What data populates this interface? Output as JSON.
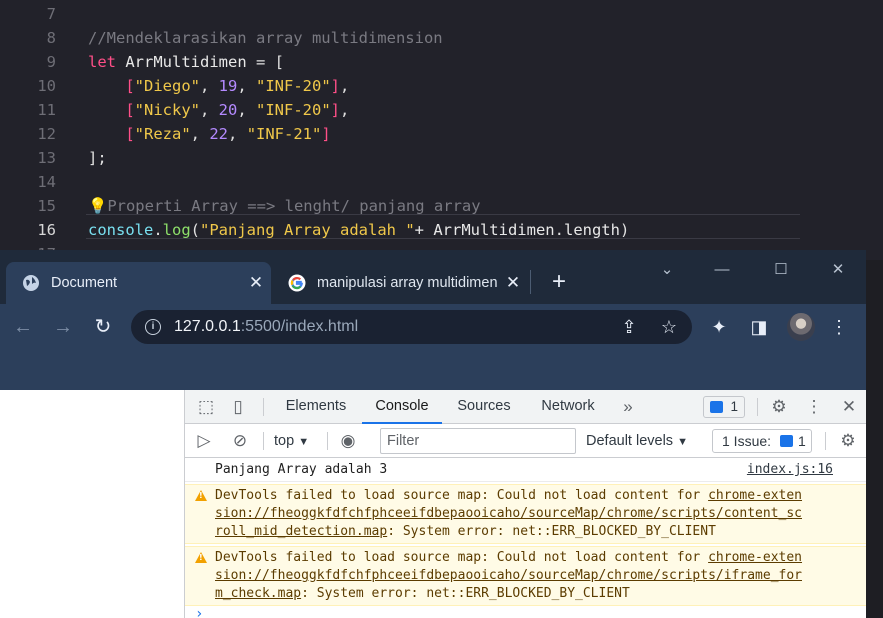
{
  "editor": {
    "lines": [
      {
        "num": "7",
        "tokens": []
      },
      {
        "num": "8",
        "tokens": [
          {
            "t": "//Mendeklarasikan array multidimension",
            "c": "comment"
          }
        ]
      },
      {
        "num": "9",
        "tokens": [
          {
            "t": "let",
            "c": "kw"
          },
          {
            "t": " ArrMultidimen ",
            "c": "id"
          },
          {
            "t": "=",
            "c": "punc"
          },
          {
            "t": " [",
            "c": "punc"
          }
        ]
      },
      {
        "num": "10",
        "tokens": [
          {
            "t": "    [",
            "c": "brk"
          },
          {
            "t": "\"Diego\"",
            "c": "str"
          },
          {
            "t": ", ",
            "c": "punc"
          },
          {
            "t": "19",
            "c": "num"
          },
          {
            "t": ", ",
            "c": "punc"
          },
          {
            "t": "\"INF-20\"",
            "c": "str"
          },
          {
            "t": "]",
            "c": "brk"
          },
          {
            "t": ",",
            "c": "punc"
          }
        ]
      },
      {
        "num": "11",
        "tokens": [
          {
            "t": "    [",
            "c": "brk"
          },
          {
            "t": "\"Nicky\"",
            "c": "str"
          },
          {
            "t": ", ",
            "c": "punc"
          },
          {
            "t": "20",
            "c": "num"
          },
          {
            "t": ", ",
            "c": "punc"
          },
          {
            "t": "\"INF-20\"",
            "c": "str"
          },
          {
            "t": "]",
            "c": "brk"
          },
          {
            "t": ",",
            "c": "punc"
          }
        ]
      },
      {
        "num": "12",
        "tokens": [
          {
            "t": "    [",
            "c": "brk"
          },
          {
            "t": "\"Reza\"",
            "c": "str"
          },
          {
            "t": ", ",
            "c": "punc"
          },
          {
            "t": "22",
            "c": "num"
          },
          {
            "t": ", ",
            "c": "punc"
          },
          {
            "t": "\"INF-21\"",
            "c": "str"
          },
          {
            "t": "]",
            "c": "brk"
          }
        ]
      },
      {
        "num": "13",
        "tokens": [
          {
            "t": "];",
            "c": "punc"
          }
        ]
      },
      {
        "num": "14",
        "tokens": []
      },
      {
        "num": "15",
        "tokens": [
          {
            "t": "💡",
            "c": "comment"
          },
          {
            "t": "Properti Array ==> lenght/ panjang array",
            "c": "comment"
          }
        ]
      },
      {
        "num": "16",
        "active": true,
        "tokens": [
          {
            "t": "console",
            "c": "obj"
          },
          {
            "t": ".",
            "c": "punc"
          },
          {
            "t": "log",
            "c": "fn"
          },
          {
            "t": "(",
            "c": "punc"
          },
          {
            "t": "\"Panjang Array adalah \"",
            "c": "str"
          },
          {
            "t": "+ ArrMultidimen",
            "c": "id"
          },
          {
            "t": ".",
            "c": "punc"
          },
          {
            "t": "length",
            "c": "id"
          },
          {
            "t": ")",
            "c": "punc"
          }
        ]
      },
      {
        "num": "17",
        "tokens": []
      }
    ]
  },
  "browser": {
    "tabs": [
      {
        "label": "Document",
        "icon": "globe-icon"
      },
      {
        "label": "manipulasi array multidimensi",
        "icon": "google-icon"
      }
    ],
    "url_host": "127.0.0.1",
    "url_rest": ":5500/index.html"
  },
  "devtools": {
    "tabs": [
      "Elements",
      "Console",
      "Sources",
      "Network"
    ],
    "active_tab": "Console",
    "message_count": "1",
    "context": "top",
    "filter_placeholder": "Filter",
    "levels": "Default levels",
    "issues_label": "1 Issue:",
    "issues_count": "1",
    "log": {
      "text": "Panjang Array adalah 3",
      "source": "index.js:16"
    },
    "warnings": [
      {
        "line1_pre": "DevTools failed to load source map: Could not load content for ",
        "line1_link": "chrome-exten",
        "line2_link": "sion://fheoggkfdfchfphceeifdbepaooicaho/sourceMap/chrome/scripts/content_sc",
        "line3_link": "roll_mid_detection.map",
        "line3_post": ": System error: net::ERR_BLOCKED_BY_CLIENT"
      },
      {
        "line1_pre": "DevTools failed to load source map: Could not load content for ",
        "line1_link": "chrome-exten",
        "line2_link": "sion://fheoggkfdfchfphceeifdbepaooicaho/sourceMap/chrome/scripts/iframe_for",
        "line3_link": "m_check.map",
        "line3_post": ": System error: net::ERR_BLOCKED_BY_CLIENT"
      }
    ]
  }
}
